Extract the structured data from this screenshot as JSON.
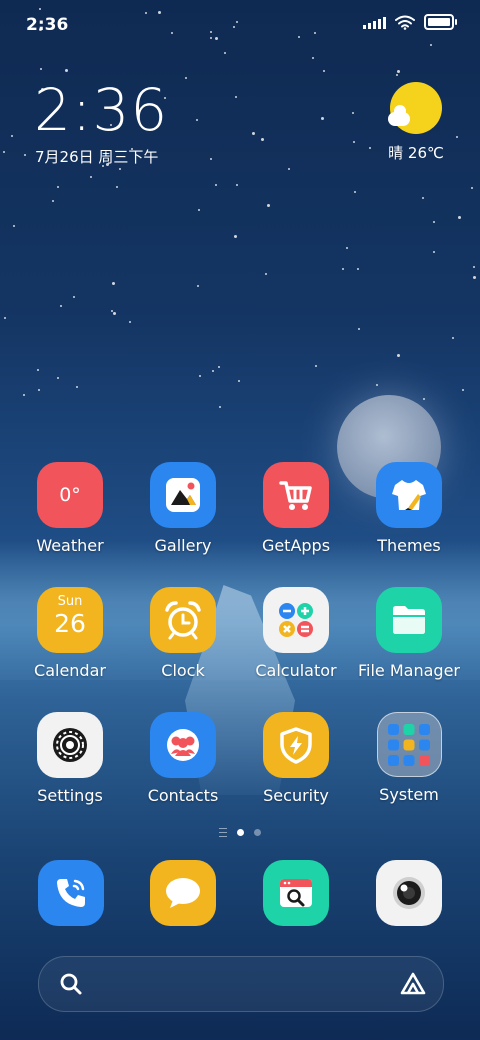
{
  "status_bar": {
    "time": "2:36",
    "icons": [
      "signal-icon",
      "wifi-icon",
      "battery-icon"
    ]
  },
  "widget": {
    "time": "2:36",
    "date": "7月26日 周三下午",
    "weather": "晴 26℃",
    "weather_icon": "sunny-icon"
  },
  "apps": [
    {
      "label": "Weather",
      "icon": "weather-icon",
      "color": "#f2545b",
      "text": "0°"
    },
    {
      "label": "Gallery",
      "icon": "gallery-icon",
      "color": "#2b86f0"
    },
    {
      "label": "GetApps",
      "icon": "cart-icon",
      "color": "#f2545b"
    },
    {
      "label": "Themes",
      "icon": "tshirt-icon",
      "color": "#2b86f0"
    },
    {
      "label": "Calendar",
      "icon": "calendar-icon",
      "color": "#f2b51f",
      "day": "Sun",
      "date": "26"
    },
    {
      "label": "Clock",
      "icon": "alarm-clock-icon",
      "color": "#f2b51f"
    },
    {
      "label": "Calculator",
      "icon": "calculator-icon",
      "color": "#f2f2f2"
    },
    {
      "label": "File Manager",
      "icon": "folder-icon",
      "color": "#1fd3a8"
    },
    {
      "label": "Settings",
      "icon": "gear-icon",
      "color": "#f2f2f2"
    },
    {
      "label": "Contacts",
      "icon": "contacts-icon",
      "color": "#2b86f0"
    },
    {
      "label": "Security",
      "icon": "shield-icon",
      "color": "#f2b51f"
    },
    {
      "label": "System",
      "icon": "folder-system-icon",
      "color": "#aab4c4"
    }
  ],
  "page_indicator": {
    "pages": 2,
    "active": 1
  },
  "dock": [
    {
      "name": "phone",
      "icon": "phone-icon",
      "color": "#2b86f0"
    },
    {
      "name": "messages",
      "icon": "message-icon",
      "color": "#f2b51f"
    },
    {
      "name": "browser",
      "icon": "browser-search-icon",
      "color": "#1fd3a8"
    },
    {
      "name": "camera",
      "icon": "camera-icon",
      "color": "#f2f2f2"
    }
  ],
  "search": {
    "left_icon": "search-icon",
    "right_icon": "assistant-icon"
  }
}
